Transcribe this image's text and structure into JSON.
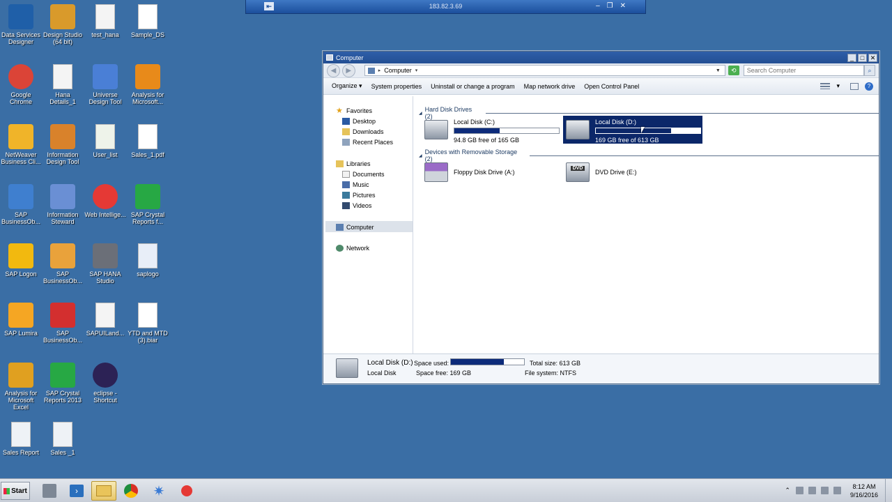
{
  "remote_bar": {
    "title": "183.82.3.69"
  },
  "desktop_icons": [
    {
      "label": "Data Services Designer",
      "icon": "data-services-icon"
    },
    {
      "label": "Design Studio (64 bit)",
      "icon": "design-studio-icon"
    },
    {
      "label": "test_hana",
      "icon": "text-file-icon"
    },
    {
      "label": "Sample_DS",
      "icon": "file-icon"
    },
    {
      "label": "Google Chrome",
      "icon": "chrome-icon"
    },
    {
      "label": "Hana Details_1",
      "icon": "text-file-icon"
    },
    {
      "label": "Universe Design Tool",
      "icon": "universe-icon"
    },
    {
      "label": "Analysis for Microsoft...",
      "icon": "analysis-icon"
    },
    {
      "label": "NetWeaver Business Cli...",
      "icon": "netweaver-icon"
    },
    {
      "label": "Information Design Tool",
      "icon": "info-design-icon"
    },
    {
      "label": "User_list",
      "icon": "csv-file-icon"
    },
    {
      "label": "Sales_1.pdf",
      "icon": "file-icon"
    },
    {
      "label": "SAP BusinessOb...",
      "icon": "sap-bo-icon"
    },
    {
      "label": "Information Steward",
      "icon": "info-steward-icon"
    },
    {
      "label": "Web Intellige...",
      "icon": "web-intelligence-icon"
    },
    {
      "label": "SAP Crystal Reports f...",
      "icon": "crystal-icon"
    },
    {
      "label": "SAP Logon",
      "icon": "sap-logon-icon"
    },
    {
      "label": "SAP BusinessOb...",
      "icon": "sap-bo-gear-icon"
    },
    {
      "label": "SAP HANA Studio",
      "icon": "hana-studio-icon"
    },
    {
      "label": "saplogo",
      "icon": "image-file-icon"
    },
    {
      "label": "SAP Lumira",
      "icon": "lumira-icon"
    },
    {
      "label": "SAP BusinessOb...",
      "icon": "sap-bo-info-icon"
    },
    {
      "label": "SAPUILand...",
      "icon": "web-file-icon"
    },
    {
      "label": "YTD and MTD (3).biar",
      "icon": "file-icon"
    },
    {
      "label": "Analysis for Microsoft Excel",
      "icon": "analysis-excel-icon"
    },
    {
      "label": "SAP Crystal Reports 2013",
      "icon": "crystal-icon"
    },
    {
      "label": "eclipse - Shortcut",
      "icon": "eclipse-icon"
    },
    {
      "label": "Sales Report",
      "icon": "spreadsheet-icon"
    },
    {
      "label": "Sales _1",
      "icon": "spreadsheet-icon"
    }
  ],
  "window": {
    "title": "Computer",
    "address": "Computer",
    "search_placeholder": "Search Computer",
    "commands": [
      "Organize",
      "System properties",
      "Uninstall or change a program",
      "Map network drive",
      "Open Control Panel"
    ],
    "nav": {
      "favorites": "Favorites",
      "desktop": "Desktop",
      "downloads": "Downloads",
      "recent": "Recent Places",
      "libraries": "Libraries",
      "documents": "Documents",
      "music": "Music",
      "pictures": "Pictures",
      "videos": "Videos",
      "computer": "Computer",
      "network": "Network"
    },
    "groups": {
      "hard_disks": "Hard Disk Drives (2)",
      "removable": "Devices with Removable Storage (2)"
    },
    "drives": [
      {
        "name": "Local Disk (C:)",
        "free": "94.8 GB free of 165 GB",
        "used_fraction": 0.43
      },
      {
        "name": "Local Disk (D:)",
        "free": "169 GB free of 613 GB",
        "used_fraction": 0.72
      },
      {
        "name": "Floppy Disk Drive (A:)"
      },
      {
        "name": "DVD Drive (E:)"
      }
    ],
    "details": {
      "name": "Local Disk (D:)",
      "type": "Local Disk",
      "space_used_label": "Space used:",
      "space_free": "Space free: 169 GB",
      "total_size": "Total size: 613 GB",
      "file_system": "File system: NTFS",
      "used_fraction": 0.72
    }
  },
  "taskbar": {
    "start": "Start",
    "time": "8:12 AM",
    "date": "9/16/2016"
  },
  "colors": {
    "desktop": "#3a6ea5",
    "selection": "#0b2769",
    "bar_fill": "#0d2b7a"
  }
}
